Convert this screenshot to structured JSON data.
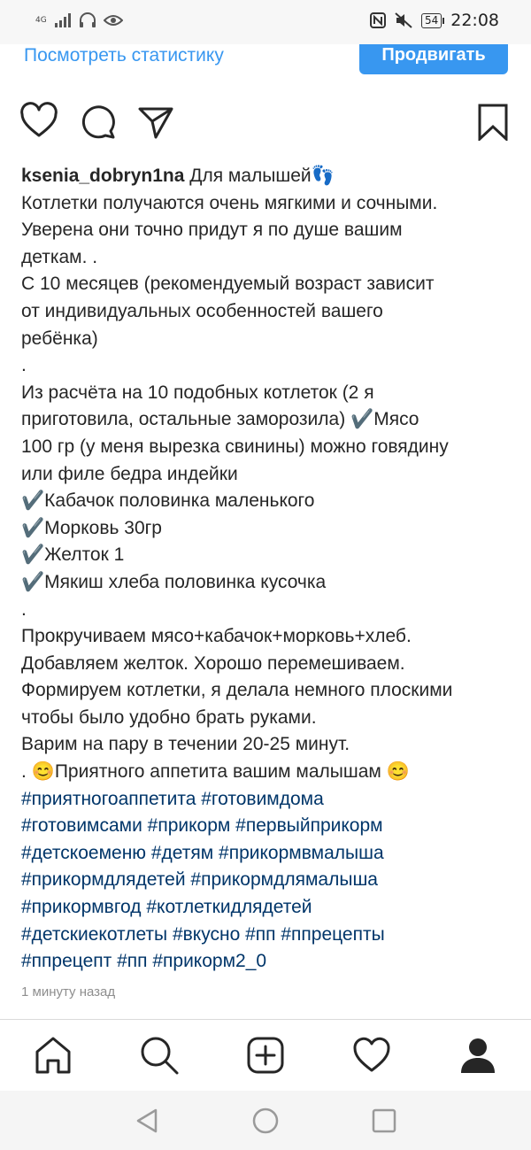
{
  "status_bar": {
    "network": "4G",
    "battery": "54",
    "time": "22:08"
  },
  "top": {
    "stats_link": "Посмотреть статистику",
    "promote_button": "Продвигать"
  },
  "actions": {
    "icons": [
      "heart-icon",
      "comment-icon",
      "share-icon",
      "bookmark-icon"
    ]
  },
  "post": {
    "username": "ksenia_dobryn1na",
    "caption_lines": [
      " Для малышей👣",
      "Котлетки получаются очень мягкими и сочными.",
      "Уверена они точно придут я по душе вашим",
      "деткам. .",
      "С 10 месяцев (рекомендуемый возраст зависит",
      "от индивидуальных особенностей вашего",
      "ребёнка)",
      ".",
      "Из расчёта на 10 подобных котлеток (2 я",
      "приготовила, остальные заморозила) ✔️Мясо",
      "100 гр (у меня вырезка свинины) можно говядину",
      "или филе бедра индейки",
      "✔️Кабачок половинка маленького",
      "✔️Морковь 30гр",
      "✔️Желток 1",
      "✔️Мякиш хлеба половинка кусочка",
      ".",
      "Прокручиваем мясо+кабачок+морковь+хлеб.",
      "Добавляем желток. Хорошо перемешиваем.",
      "Формируем котлетки, я делала немного плоскими",
      "чтобы было удобно брать руками.",
      "Варим на пару в течении 20-25 минут.",
      ". 😊Приятного аппетита вашим малышам 😊"
    ],
    "hashtag_lines": [
      "#приятногоаппетита #готовимдома",
      "#готовимсами #прикорм #первыйприкорм",
      "#детскоеменю #детям #прикормвмалыша",
      "#прикормдлядетей #прикормдлямалыша",
      "#прикормвгод #котлеткидлядетей",
      "#детскиекотлеты #вкусно #пп #ппрецепты",
      "#ппрецепт #пп #прикорм2_0"
    ],
    "timestamp": "1 минуту назад"
  },
  "tab_bar": {
    "icons": [
      "home-icon",
      "search-icon",
      "new-post-icon",
      "activity-icon",
      "profile-icon"
    ]
  },
  "nav_bar": {
    "icons": [
      "back-icon",
      "home-circle-icon",
      "recents-icon"
    ]
  }
}
